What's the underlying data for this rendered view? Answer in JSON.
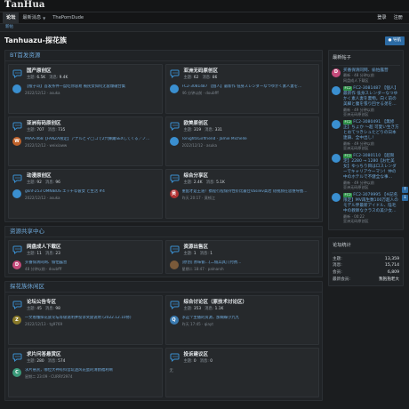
{
  "brand": {
    "logo_mark": "T",
    "logo_rest": "anHua"
  },
  "nav": {
    "tabs": [
      {
        "label": "论坛",
        "active": true,
        "caret": false
      },
      {
        "label": "最新消息",
        "active": false,
        "caret": true
      },
      {
        "label": "ThePornDude",
        "active": false,
        "caret": false
      }
    ],
    "login": "登录",
    "register": "注册"
  },
  "subnav": {
    "label": "新帖"
  },
  "page": {
    "title": "Tanhuazu-探花族",
    "nav_button": "导航"
  },
  "sections": [
    {
      "title": "BT首发资源",
      "forums": [
        {
          "name": "国产原创区",
          "stats": [
            {
              "k": "主题:",
              "v": "6.5K"
            },
            {
              "k": "消息:",
              "v": "9.4K"
            }
          ],
          "last_title": "【橙子哥】首发条件一度吃你容易 被民女如何无套爆破合集",
          "last_meta": "2022/12/12 · asuka",
          "avatar": "",
          "avatar_color": "#3a8fd0"
        },
        {
          "name": "亚洲无码原创区",
          "stats": [
            {
              "k": "主题:",
              "v": "62"
            },
            {
              "k": "消息:",
              "v": "86"
            }
          ],
          "last_title": "FC2-3081487 【個人】最新作 低身スレンダーなつゆかく素人妻を…",
          "last_meta": "46 分钟以前 · doubfff",
          "avatar": "",
          "avatar_color": "#3a8fd0"
        },
        {
          "name": "亚洲有码原创区",
          "stats": [
            {
              "k": "主题:",
              "v": "707"
            },
            {
              "k": "消息:",
              "v": "735"
            }
          ],
          "last_title": "MIAA-468【FANZA限定】アナルとマ◯コで2穴舞踊SEXしてくる／ノ…",
          "last_meta": "2022/12/12 · weixiaww",
          "avatar": "W",
          "avatar_color": "#c0622a"
        },
        {
          "name": "欧美原创区",
          "stats": [
            {
              "k": "主题:",
              "v": "319"
            },
            {
              "k": "消息:",
              "v": "331"
            }
          ],
          "last_title": "TonightsGirlfriend - Jamie Michelle",
          "last_meta": "2022/12/12 · asuka",
          "avatar": "",
          "avatar_color": "#3a8fd0"
        },
        {
          "name": "动漫原创区",
          "stats": [
            {
              "k": "主题:",
              "v": "92"
            },
            {
              "k": "消息:",
              "v": "96"
            }
          ],
          "last_title": "gknf-253 OMNIBUS エッチな彼女 と生活 #4",
          "last_meta": "2022/12/12 · asuka",
          "avatar": "",
          "avatar_color": "#3a8fd0"
        },
        {
          "name": "综合分享区",
          "stats": [
            {
              "k": "主题:",
              "v": "2.4K"
            },
            {
              "k": "消息:",
              "v": "5.1K"
            }
          ],
          "last_title": "重配才是王道！携程行程保持性价比最佳Vasilev高岩 短视频在思维导图…",
          "last_meta": "昨天 20:17 · 莫顿江",
          "avatar": "吴",
          "avatar_color": "#b13232"
        }
      ]
    },
    {
      "title": "资源共享中心",
      "forums": [
        {
          "name": "网盘成人下载区",
          "stats": [
            {
              "k": "主题:",
              "v": "11"
            },
            {
              "k": "消息:",
              "v": "23"
            }
          ],
          "last_title": "买番保清同网、偷怕露营",
          "last_meta": "48 分钟以前 · doubfff",
          "avatar": "D",
          "avatar_color": "#c44a7a",
          "short": true
        },
        {
          "name": "资源出售区",
          "stats": [
            {
              "k": "主题:",
              "v": "1"
            },
            {
              "k": "消息:",
              "v": "1"
            }
          ],
          "last_title": "[原创]  原味偷…[二偷兵具] [付费…",
          "last_meta": "星期二 18:47 · palnarsh",
          "avatar": "",
          "avatar_color": "#7a5a3a",
          "short": true
        }
      ]
    },
    {
      "title": "探花族休闲区",
      "forums": [
        {
          "name": "论坛公告专区",
          "stats": [
            {
              "k": "主题:",
              "v": "45"
            },
            {
              "k": "消息:",
              "v": "98"
            }
          ],
          "last_title": "一文看懂探花族论坛等级说明并投诉奖励说明 (2022.12.10修)",
          "last_meta": "2022/12/13 · tg9769",
          "avatar": "Z",
          "avatar_color": "#8a7a2a"
        },
        {
          "name": "综合讨论区（原技术讨论区）",
          "stats": [
            {
              "k": "主题:",
              "v": "353"
            },
            {
              "k": "消息:",
              "v": "1.1K"
            }
          ],
          "last_title": "求这个主播的资源，加蝴蝶小九九",
          "last_meta": "昨天 17:45 · qiayt",
          "avatar": "Q",
          "avatar_color": "#3a7ab0"
        },
        {
          "name": "求片问答悬赏区",
          "stats": [
            {
              "k": "主题:",
              "v": "280"
            },
            {
              "k": "消息:",
              "v": "574"
            }
          ],
          "last_title": "求片悬赏，哪位大神有抖音玩迷风花蛋的清鹤福利啊",
          "last_meta": "星期二 23:09 · CURRY2974",
          "avatar": "C",
          "avatar_color": "#3b9a7a"
        },
        {
          "name": "投诉建议区",
          "stats": [
            {
              "k": "主题:",
              "v": "0"
            },
            {
              "k": "消息:",
              "v": "0"
            }
          ],
          "last_title": "",
          "last_meta": "无",
          "avatar": "",
          "avatar_color": "#3a8fd0"
        }
      ]
    }
  ],
  "sidebar": {
    "latest_title": "最新帖子",
    "posts": [
      {
        "tag": "",
        "text": "买番保清同网、偷怕露营",
        "meta": "最新 · 48 分钟以前",
        "sub": "网盘成人下载区",
        "avatar": "D",
        "avatar_color": "#c44a7a"
      },
      {
        "tag": "FC2",
        "text": "FC2-3081487 【個人】最新作 低身スレンダーなつゆかく素人妻を裏物。向く前の美脚と腹を張り回せる弟を…",
        "meta": "最新 · 49 分钟以前",
        "sub": "亚洲无码原创区",
        "avatar": "",
        "avatar_color": "#3a8fd0"
      },
      {
        "tag": "FC2",
        "text": "FC2-3080491 【無修正】ちょか ～超 可愛い生き方とおてつきシュたどりの日本連鎖、全中出し！",
        "meta": "最新 · 49 分钟以前",
        "sub": "亚洲无码原创区",
        "avatar": "",
        "avatar_color": "#3a8fd0"
      },
      {
        "tag": "FC2",
        "text": "FC2-3080110 【超限定】2280 → 1280【お忙美女】ゆっちり目はロスレンダーでキャリアウーマン！仲の中のホテルで不健全な事…",
        "meta": "最新 · 49 分钟以前",
        "sub": "亚洲无码原创区",
        "avatar": "",
        "avatar_color": "#3a8fd0"
      },
      {
        "tag": "FC2",
        "text": "FC2-3079995 【※記名限定】MV再生数100万超人のモデル界最新アイドル、陰毛中の教師なクラスの美少女…",
        "meta": "最新 · 00:22",
        "sub": "亚洲无码原创区",
        "avatar": "",
        "avatar_color": "#3a8fd0"
      }
    ],
    "stats_title": "论坛统计",
    "stats": [
      {
        "k": "主题:",
        "v": "13,359"
      },
      {
        "k": "消息:",
        "v": "15,714"
      },
      {
        "k": "会员:",
        "v": "6,809"
      },
      {
        "k": "最新会员:",
        "v": "我抱抱老大"
      }
    ]
  }
}
